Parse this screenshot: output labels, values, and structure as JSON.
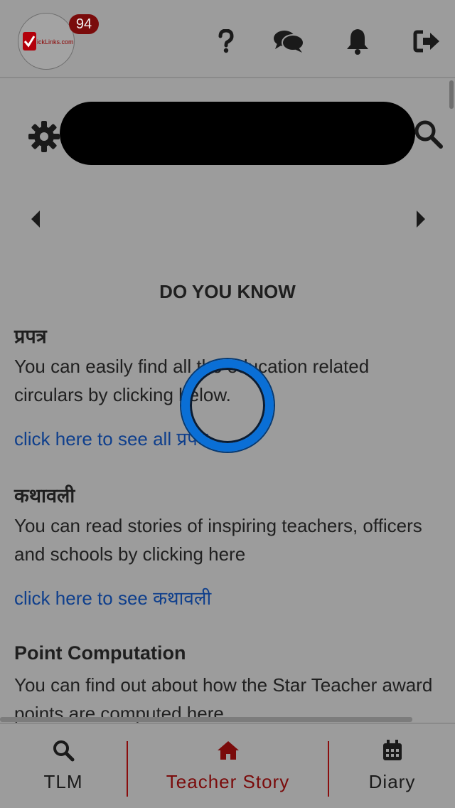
{
  "header": {
    "logo_text": "ickLinks.com",
    "notification_count": "94",
    "icons": [
      "help-icon",
      "chat-icon",
      "bell-icon",
      "logout-icon"
    ]
  },
  "search": {
    "settings_icon": "gear-icon",
    "search_icon": "search-icon"
  },
  "carousel": {
    "prev_icon": "caret-left-icon",
    "next_icon": "caret-right-icon"
  },
  "main": {
    "section_title": "DO YOU KNOW",
    "blocks": [
      {
        "title": "प्रपत्र",
        "text": "You can easily find all the education related circulars by clicking below.",
        "link": "click here to see all प्रपत्र"
      },
      {
        "title": "कथावली",
        "text": "You can read stories of inspiring teachers, officers and schools by clicking here",
        "link": "click here to see कथावली"
      },
      {
        "title": "Point Computation",
        "text": "You can find out about how the Star Teacher award points are computed here"
      }
    ]
  },
  "bottom_nav": {
    "items": [
      {
        "label": "TLM",
        "icon": "search-icon"
      },
      {
        "label": "Teacher Story",
        "icon": "home-icon",
        "active": true
      },
      {
        "label": "Diary",
        "icon": "calendar-icon"
      }
    ]
  },
  "colors": {
    "active": "#7a0b0b",
    "link": "#0f3f8c",
    "divider": "#8a0d0d"
  }
}
